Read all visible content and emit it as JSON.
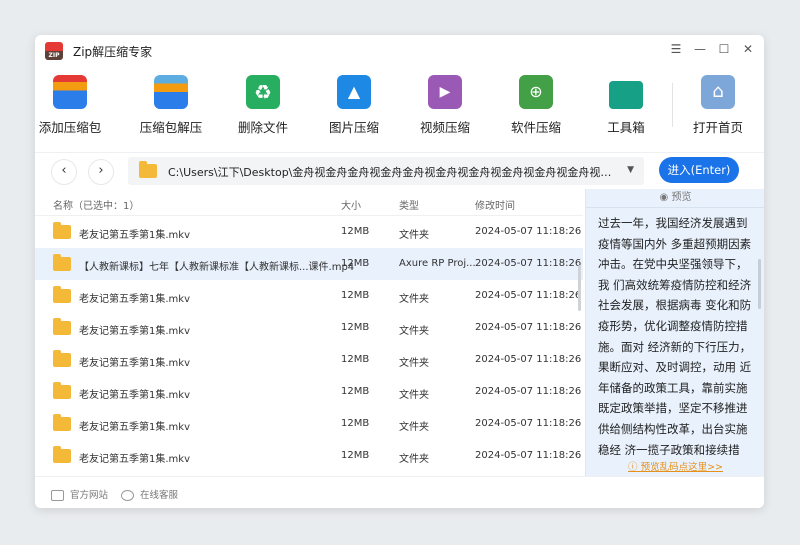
{
  "app": {
    "title": "Zip解压缩专家",
    "logo_text": "ZIP"
  },
  "toolbar": [
    {
      "label": "添加压缩包",
      "icon": "add-archive-icon",
      "color": "#2b7de9"
    },
    {
      "label": "压缩包解压",
      "icon": "extract-archive-icon",
      "color": "#2b7de9"
    },
    {
      "label": "删除文件",
      "icon": "recycle-icon",
      "color": "#27ae60"
    },
    {
      "label": "图片压缩",
      "icon": "image-compress-icon",
      "color": "#1e88e5"
    },
    {
      "label": "视频压缩",
      "icon": "video-compress-icon",
      "color": "#9b59b6"
    },
    {
      "label": "软件压缩",
      "icon": "software-compress-icon",
      "color": "#43a047"
    },
    {
      "label": "工具箱",
      "icon": "toolbox-icon",
      "color": "#16a085"
    },
    {
      "label": "打开首页",
      "icon": "home-icon",
      "color": "#7da7d9"
    }
  ],
  "pathbar": {
    "path": "C:\\Users\\江下\\Desktop\\金舟视金舟金舟视金舟金舟视金舟视金舟视金舟视金舟视金舟视金舟视金...",
    "enter_label": "进入(Enter)"
  },
  "list": {
    "headers": {
      "name": "名称（已选中：1）",
      "size": "大小",
      "type": "类型",
      "modified": "修改时间"
    },
    "rows": [
      {
        "name": "老友记第五季第1集.mkv",
        "size": "12MB",
        "type": "文件夹",
        "modified": "2024-05-07 11:18:26"
      },
      {
        "name": "【人教新课标】七年【人教新课标准【人教新课标...课件.mp4",
        "size": "12MB",
        "type": "Axure RP Proj...",
        "modified": "2024-05-07 11:18:26"
      },
      {
        "name": "老友记第五季第1集.mkv",
        "size": "12MB",
        "type": "文件夹",
        "modified": "2024-05-07 11:18:26"
      },
      {
        "name": "老友记第五季第1集.mkv",
        "size": "12MB",
        "type": "文件夹",
        "modified": "2024-05-07 11:18:26"
      },
      {
        "name": "老友记第五季第1集.mkv",
        "size": "12MB",
        "type": "文件夹",
        "modified": "2024-05-07 11:18:26"
      },
      {
        "name": "老友记第五季第1集.mkv",
        "size": "12MB",
        "type": "文件夹",
        "modified": "2024-05-07 11:18:26"
      },
      {
        "name": "老友记第五季第1集.mkv",
        "size": "12MB",
        "type": "文件夹",
        "modified": "2024-05-07 11:18:26"
      },
      {
        "name": "老友记第五季第1集.mkv",
        "size": "12MB",
        "type": "文件夹",
        "modified": "2024-05-07 11:18:26"
      }
    ]
  },
  "preview": {
    "title": "预览",
    "text": "过去一年，我国经济发展遇到疫情等国内外 多重超预期因素冲击。在党中央坚强领导下，我 们高效统筹疫情防控和经济社会发展，根据病毒 变化和防疫形势，优化调整疫情防控措施。面对 经济新的下行压力，果断应对、及时调控，动用 近年储备的政策工具，靠前实施既定政策举措，坚定不移推进供给侧结构性改革，出台实施稳经 济一揽子政策和接续措施，部署稳住经济大盘工作，加强对地方落实政策的督导服务",
    "link": "预览乱码点这里>>"
  },
  "footer": {
    "website": "官方网站",
    "service": "在线客服"
  }
}
